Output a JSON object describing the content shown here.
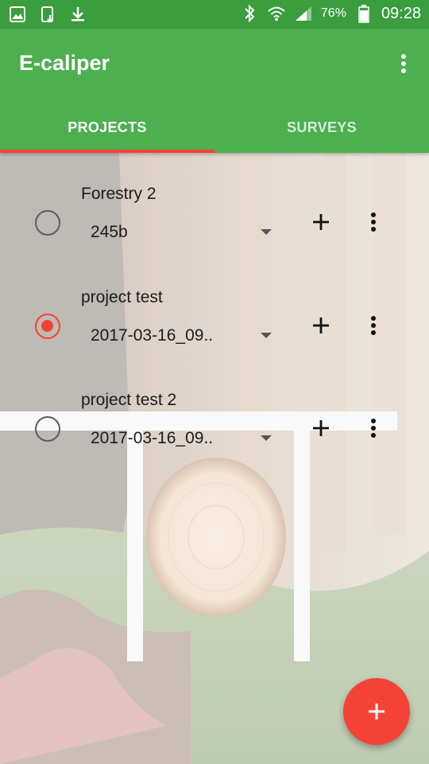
{
  "status_bar": {
    "battery_percent": "76%",
    "time": "09:28",
    "icons": [
      "image-icon",
      "tablet-download-icon",
      "download-icon",
      "bluetooth-icon",
      "wifi-icon",
      "signal-icon",
      "battery-icon"
    ]
  },
  "app_bar": {
    "title": "E-caliper",
    "overflow_icon": "more-vert-icon"
  },
  "tabs": [
    {
      "label": "PROJECTS",
      "active": true
    },
    {
      "label": "SURVEYS",
      "active": false
    }
  ],
  "projects": [
    {
      "name": "Forestry 2",
      "survey": "245b",
      "selected": false
    },
    {
      "name": "project test",
      "survey": "2017-03-16_09..",
      "selected": true
    },
    {
      "name": "project test 2",
      "survey": "2017-03-16_09..",
      "selected": false
    }
  ],
  "fab": {
    "icon": "plus-icon"
  },
  "colors": {
    "status_bar": "#3a9d3e",
    "app_bar": "#4caf50",
    "accent": "#f44336",
    "tab_indicator": "#f44336"
  }
}
